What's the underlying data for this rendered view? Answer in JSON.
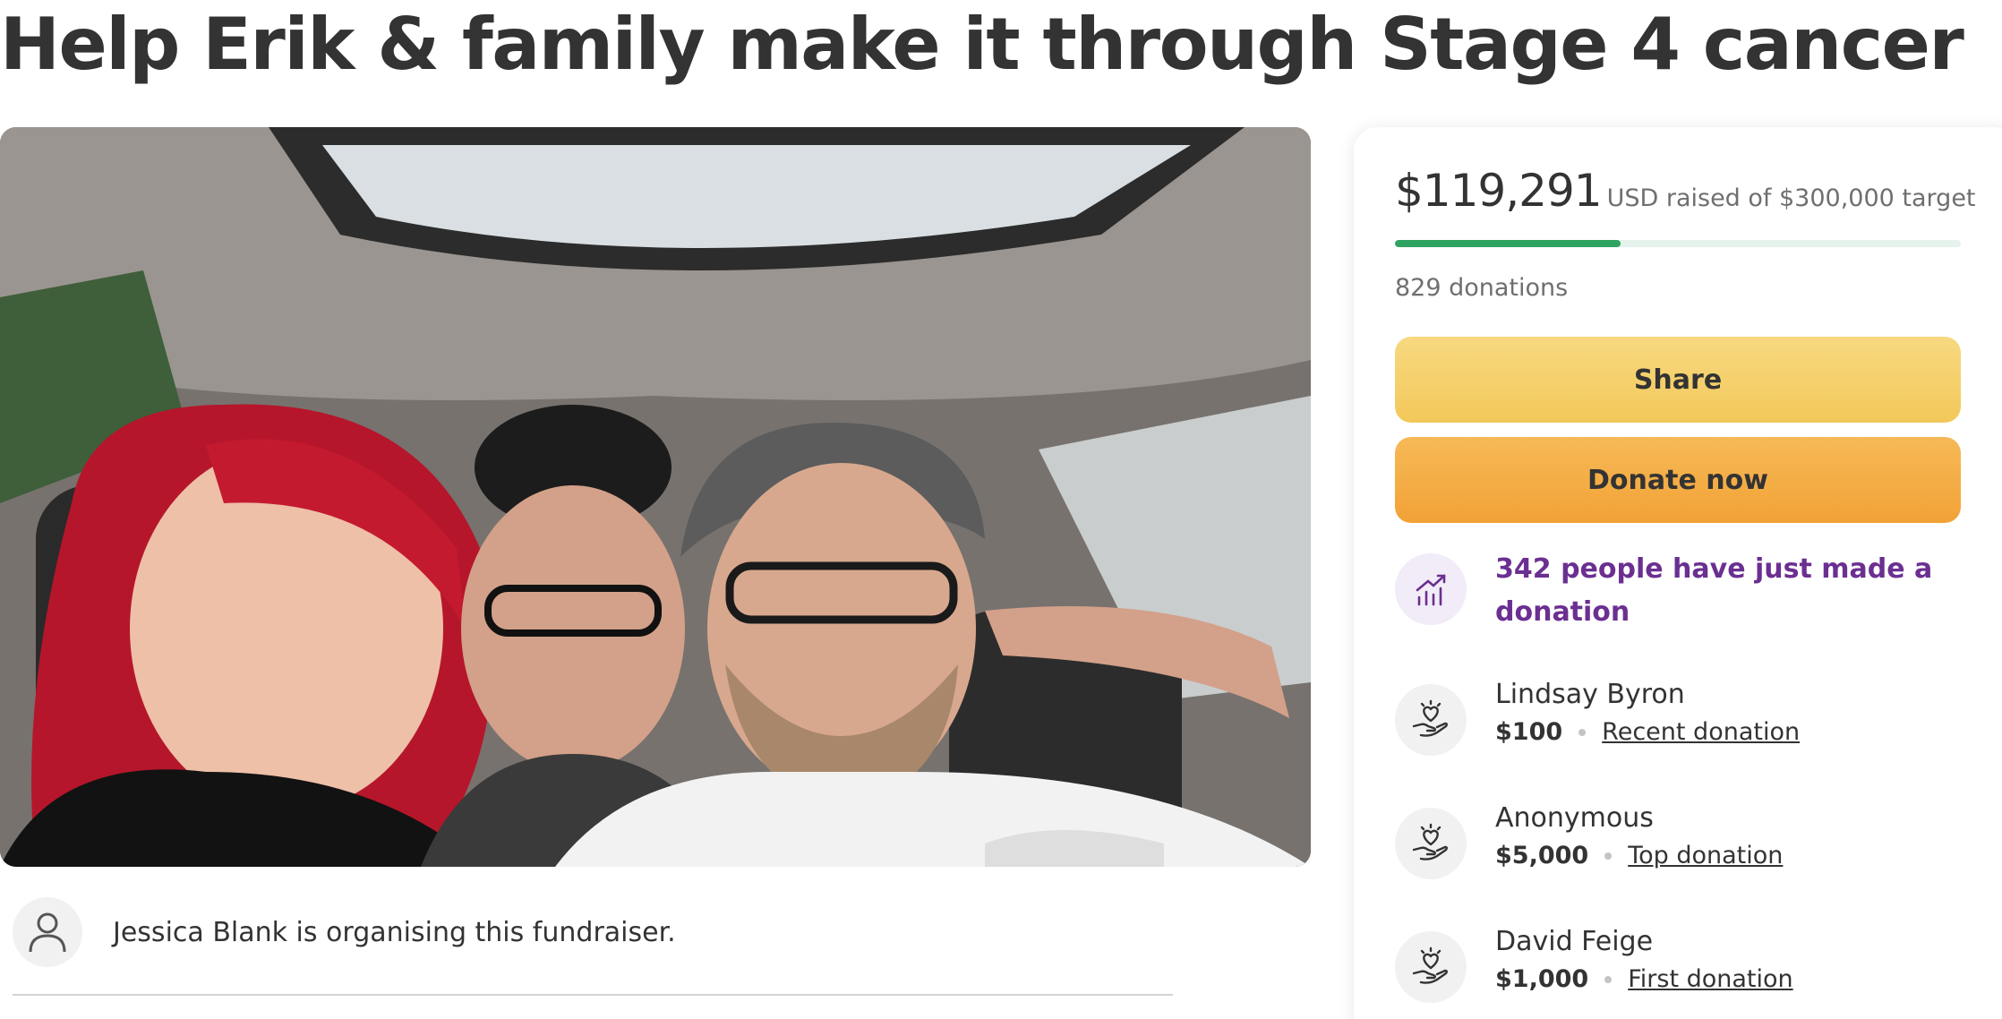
{
  "campaign": {
    "title": "Help Erik & family make it through Stage 4 cancer",
    "organiser_text": "Jessica Blank is organising this fundraiser."
  },
  "progress": {
    "amount": "$119,291",
    "raised_text": "USD raised of $300,000 target",
    "fraction": 0.398,
    "donations": "829 donations"
  },
  "buttons": {
    "share": "Share",
    "donate": "Donate now"
  },
  "recent_activity": {
    "text": "342 people have just made a donation",
    "icon": "trending-up-icon"
  },
  "donors": [
    {
      "name": "Lindsay Byron",
      "amount": "$100",
      "tag": "Recent donation",
      "icon": "heart-hand-icon"
    },
    {
      "name": "Anonymous",
      "amount": "$5,000",
      "tag": "Top donation",
      "icon": "heart-hand-icon"
    },
    {
      "name": "David Feige",
      "amount": "$1,000",
      "tag": "First donation",
      "icon": "heart-hand-icon"
    }
  ],
  "colors": {
    "accent_green": "#2fa360",
    "accent_purple": "#6b2f91",
    "share_button": "#f3c85a",
    "donate_button": "#f2a236"
  }
}
